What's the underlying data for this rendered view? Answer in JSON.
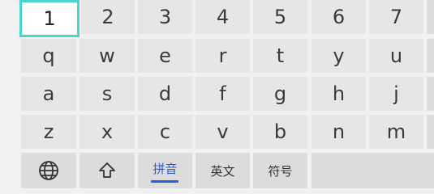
{
  "keyboard": {
    "number_row": [
      "1",
      "2",
      "3",
      "4",
      "5",
      "6",
      "7"
    ],
    "row_q": [
      "q",
      "w",
      "e",
      "r",
      "t",
      "y",
      "u"
    ],
    "row_a": [
      "a",
      "s",
      "d",
      "f",
      "g",
      "h",
      "j"
    ],
    "row_z": [
      "z",
      "x",
      "c",
      "v",
      "b",
      "n",
      "m"
    ],
    "bottom": {
      "globe_icon": "globe-icon",
      "shift_icon": "shift-icon",
      "pinyin_label": "拼音",
      "english_label": "英文",
      "symbols_label": "符号"
    },
    "colors": {
      "active_key_border": "#49d6cf",
      "selected_mode": "#2a5bd7"
    }
  }
}
